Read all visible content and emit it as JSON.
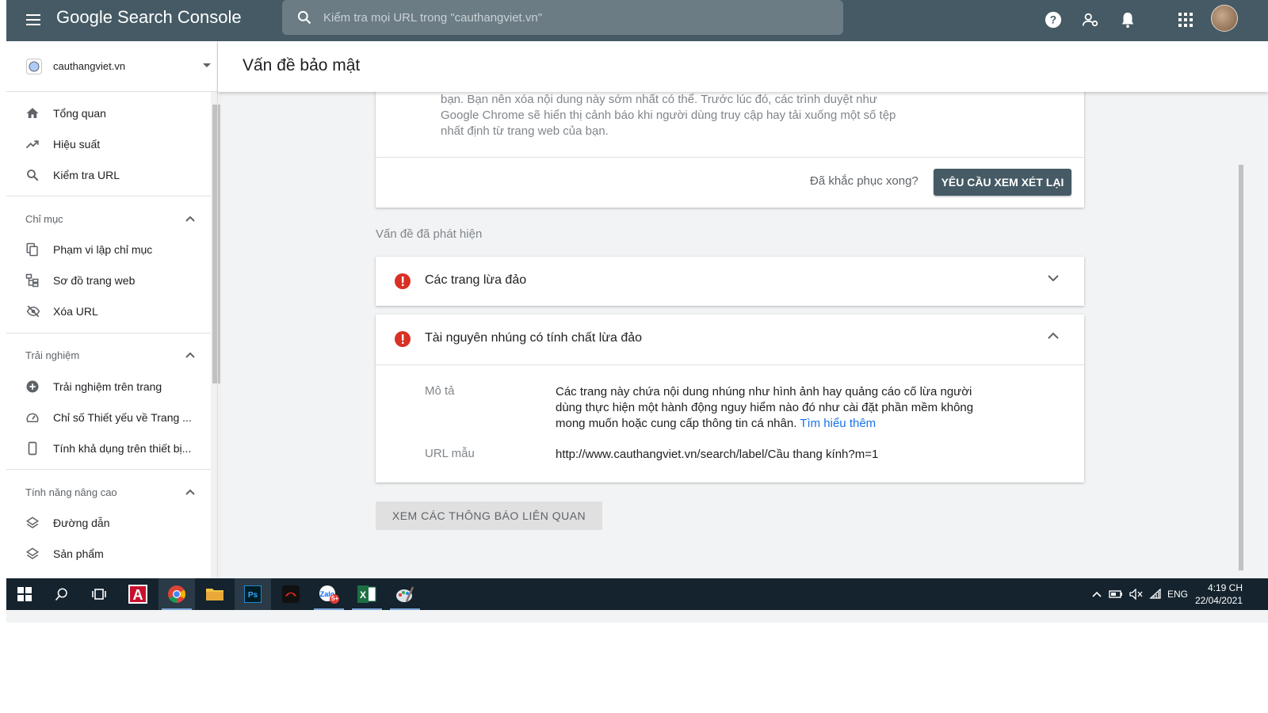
{
  "app": {
    "title": "Google Search Console",
    "search_placeholder": "Kiểm tra mọi URL trong \"cauthangviet.vn\""
  },
  "sidebar": {
    "property": "cauthangviet.vn",
    "top_items": [
      {
        "label": "Tổng quan",
        "icon": "home-icon"
      },
      {
        "label": "Hiệu suất",
        "icon": "trending-up-icon"
      },
      {
        "label": "Kiểm tra URL",
        "icon": "search-icon"
      }
    ],
    "sections": [
      {
        "title": "Chỉ mục",
        "items": [
          {
            "label": "Phạm vi lập chỉ mục",
            "icon": "copy-icon"
          },
          {
            "label": "Sơ đồ trang web",
            "icon": "sitemap-icon"
          },
          {
            "label": "Xóa URL",
            "icon": "eye-off-icon"
          }
        ]
      },
      {
        "title": "Trải nghiệm",
        "items": [
          {
            "label": "Trải nghiệm trên trang",
            "icon": "add-circle-icon"
          },
          {
            "label": "Chỉ số Thiết yếu về Trang ...",
            "icon": "speed-icon"
          },
          {
            "label": "Tính khả dụng trên thiết bị...",
            "icon": "phone-icon"
          }
        ]
      },
      {
        "title": "Tính năng nâng cao",
        "items": [
          {
            "label": "Đường dẫn",
            "icon": "layers-icon"
          },
          {
            "label": "Sản phẩm",
            "icon": "layers-icon"
          }
        ]
      }
    ]
  },
  "page": {
    "title": "Vấn đề bảo mật",
    "warning_text": "bạn. Bạn nên xóa nội dung này sớm nhất có thể. Trước lúc đó, các trình duyệt như Google Chrome sẽ hiển thị cảnh báo khi người dùng truy cập hay tải xuống một số tệp nhất định từ trang web của bạn.",
    "fixed_question": "Đã khắc phục xong?",
    "review_button": "YÊU CẦU XEM XÉT LẠI",
    "issues_label": "Vấn đề đã phát hiện",
    "issues": [
      {
        "title": "Các trang lừa đảo",
        "expanded": false
      },
      {
        "title": "Tài nguyên nhúng có tính chất lừa đảo",
        "expanded": true,
        "desc_label": "Mô tả",
        "desc_text": "Các trang này chứa nội dung nhúng như hình ảnh hay quảng cáo cố lừa người dùng thực hiện một hành động nguy hiểm nào đó như cài đặt phần mềm không mong muốn hoặc cung cấp thông tin cá nhân.",
        "learn_more": "Tìm hiểu thêm",
        "url_label": "URL mẫu",
        "url_value": "http://www.cauthangviet.vn/search/label/Cầu thang kính?m=1"
      }
    ],
    "related_button": "XEM CÁC THÔNG BÁO LIÊN QUAN"
  },
  "taskbar": {
    "language": "ENG",
    "time": "4:19 CH",
    "date": "22/04/2021",
    "zalo_badge": "5+"
  },
  "colors": {
    "topbar": "#455a64",
    "error": "#d93025",
    "link": "#1a73e8",
    "taskbar": "#14232e"
  }
}
